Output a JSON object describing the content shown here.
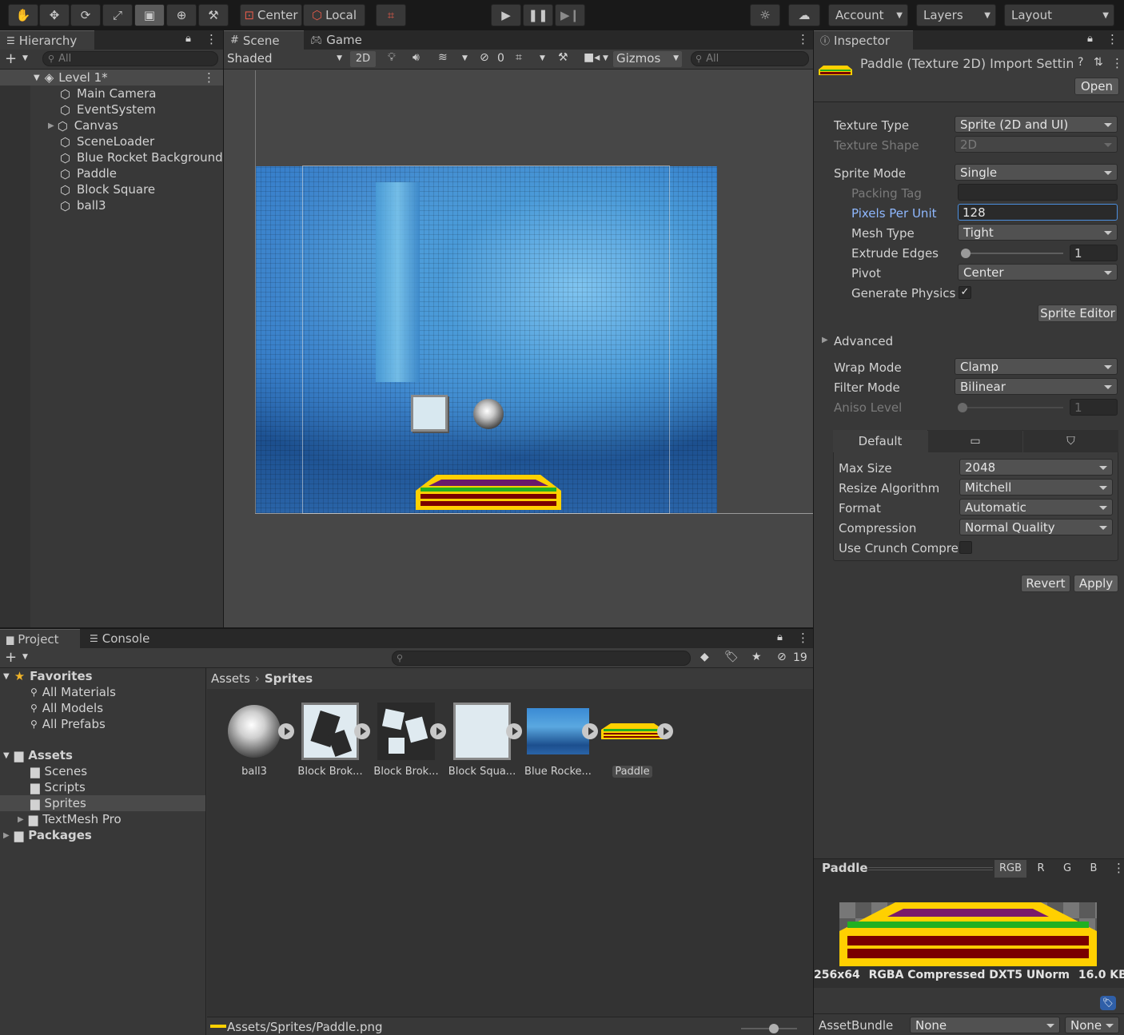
{
  "toolbar": {
    "pivot_mode": "Center",
    "pivot_space": "Local",
    "account": "Account",
    "layers": "Layers",
    "layout": "Layout"
  },
  "hierarchy": {
    "tab": "Hierarchy",
    "search_placeholder": "All",
    "scene": "Level 1*",
    "items": [
      "Main Camera",
      "EventSystem",
      "Canvas",
      "SceneLoader",
      "Blue Rocket Background",
      "Paddle",
      "Block Square",
      "ball3"
    ]
  },
  "scene_view": {
    "tab_scene": "Scene",
    "tab_game": "Game",
    "shading": "Shaded",
    "mode_2d": "2D",
    "hidden_count": "0",
    "gizmos": "Gizmos",
    "search_placeholder": "All"
  },
  "inspector": {
    "tab": "Inspector",
    "title": "Paddle (Texture 2D) Import Settin",
    "open": "Open",
    "texture_type_label": "Texture Type",
    "texture_type": "Sprite (2D and UI)",
    "texture_shape_label": "Texture Shape",
    "texture_shape": "2D",
    "sprite_mode_label": "Sprite Mode",
    "sprite_mode": "Single",
    "packing_tag_label": "Packing Tag",
    "ppu_label": "Pixels Per Unit",
    "ppu": "128",
    "mesh_type_label": "Mesh Type",
    "mesh_type": "Tight",
    "extrude_label": "Extrude Edges",
    "extrude": "1",
    "pivot_label": "Pivot",
    "pivot": "Center",
    "gen_physics_label": "Generate Physics",
    "sprite_editor": "Sprite Editor",
    "advanced": "Advanced",
    "wrap_label": "Wrap Mode",
    "wrap": "Clamp",
    "filter_label": "Filter Mode",
    "filter": "Bilinear",
    "aniso_label": "Aniso Level",
    "aniso": "1",
    "platform_default": "Default",
    "max_size_label": "Max Size",
    "max_size": "2048",
    "resize_label": "Resize Algorithm",
    "resize": "Mitchell",
    "format_label": "Format",
    "format": "Automatic",
    "compression_label": "Compression",
    "compression": "Normal Quality",
    "crunch_label": "Use Crunch Compres",
    "revert": "Revert",
    "apply": "Apply",
    "preview_title": "Paddle",
    "channels": [
      "RGB",
      "R",
      "G",
      "B"
    ],
    "preview_info_dims": "256x64",
    "preview_info_format": "RGBA Compressed DXT5 UNorm",
    "preview_info_size": "16.0 KB",
    "assetbundle_label": "AssetBundle",
    "assetbundle": "None",
    "assetbundle_variant": "None"
  },
  "project": {
    "tab_project": "Project",
    "tab_console": "Console",
    "hidden_count": "19",
    "favorites": "Favorites",
    "fav_items": [
      "All Materials",
      "All Models",
      "All Prefabs"
    ],
    "assets": "Assets",
    "folders": [
      "Scenes",
      "Scripts",
      "Sprites",
      "TextMesh Pro"
    ],
    "packages": "Packages",
    "breadcrumb_root": "Assets",
    "breadcrumb_current": "Sprites",
    "asset_labels": [
      "ball3",
      "Block Brok...",
      "Block Brok...",
      "Block Squa...",
      "Blue Rocke...",
      "Paddle"
    ],
    "status_path": "Assets/Sprites/Paddle.png"
  },
  "colors": {
    "accent_blue": "#8fb8ff",
    "paddle_yellow": "#ffd000",
    "paddle_green": "#22b022",
    "paddle_maroon": "#7a0000"
  }
}
